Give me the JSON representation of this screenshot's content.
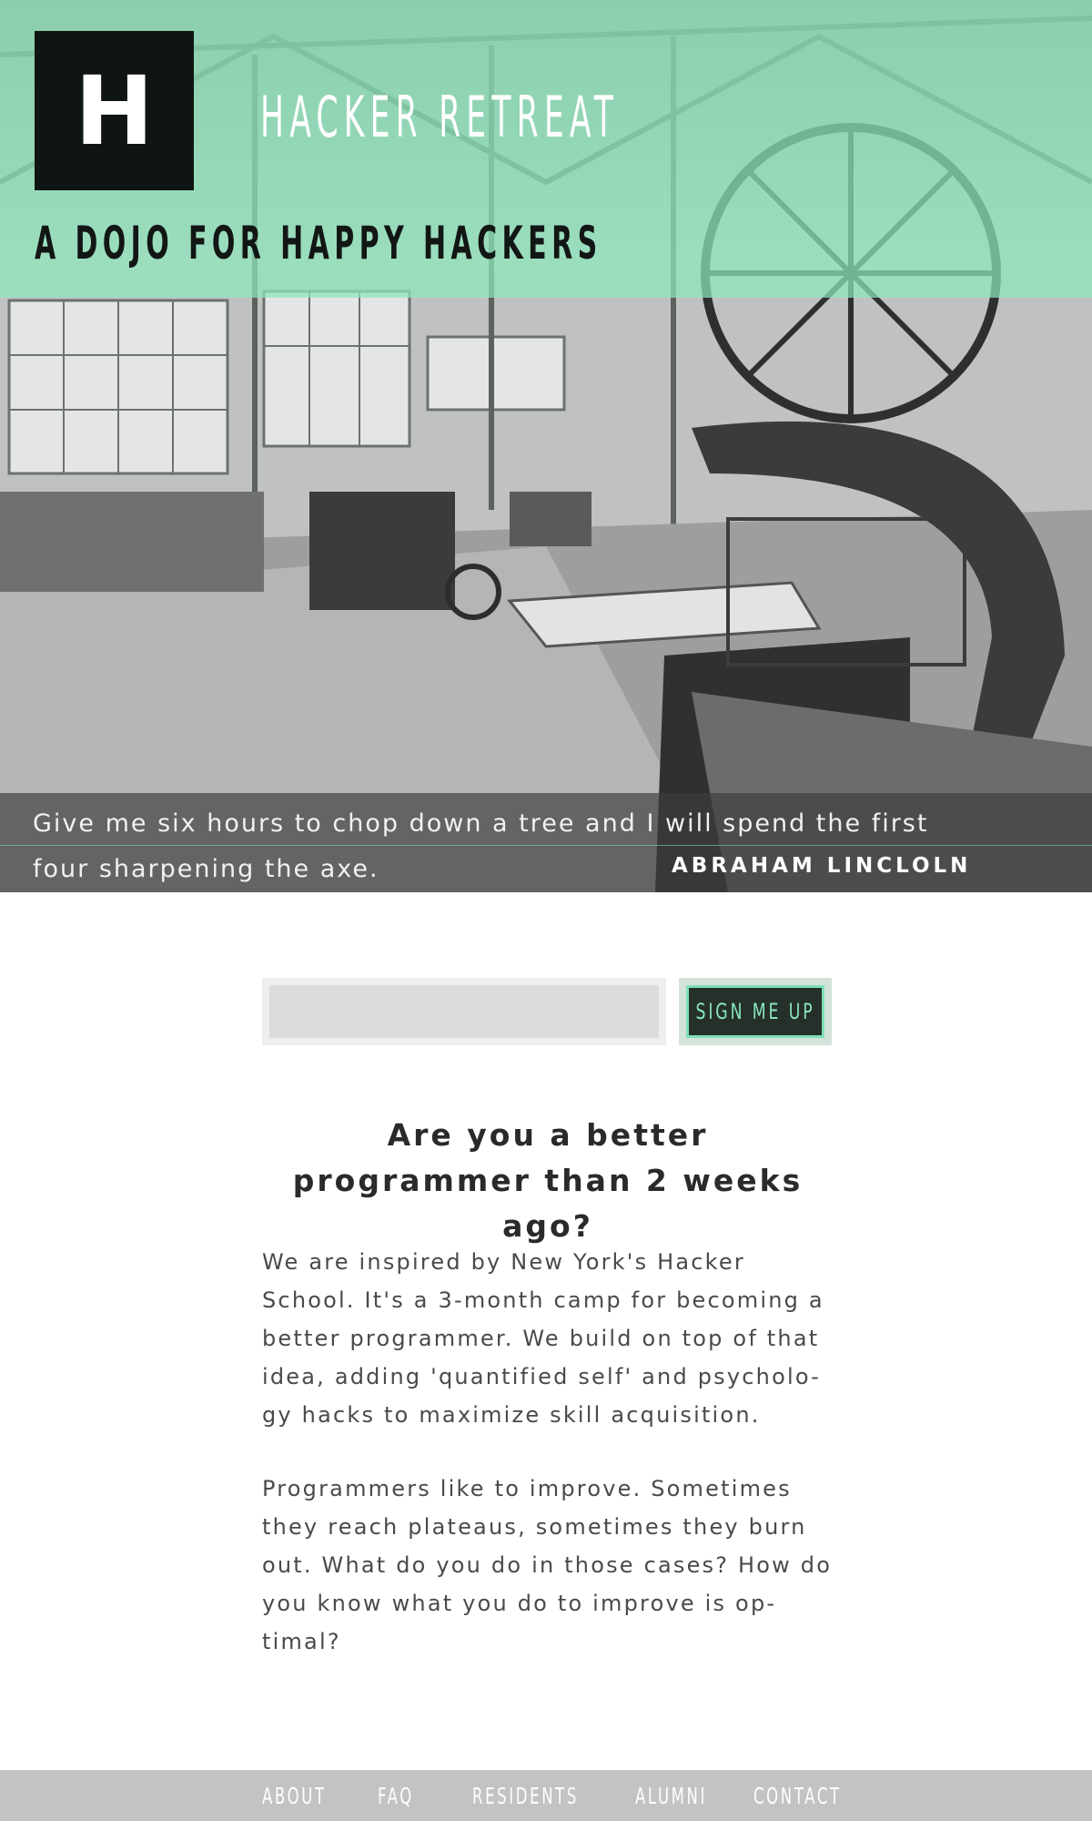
{
  "brand": {
    "logo_letter": "H",
    "title": "HACKER RETREAT",
    "tagline": "A DOJO FOR HAPPY HACKERS"
  },
  "quote": {
    "text": "Give me six hours to chop down a tree and I will spend the first four sharpening the axe.",
    "author": "ABRAHAM LINCLOLN"
  },
  "signup": {
    "email_value": "",
    "email_placeholder": "",
    "button_label": "SIGN ME UP"
  },
  "content": {
    "headline": "Are you a better programmer than 2 weeks ago?",
    "paragraphs": [
      "We are inspired by New York's Hacker School. It's a 3-month camp for becoming a better programmer. We build on top of that idea, adding 'quantified self' and psycholo-gy hacks to maximize skill acquisition.",
      "Programmers like to improve. Sometimes they reach plateaus, sometimes they burn out. What do you do in those cases? How do you know what you do to improve is op-timal?"
    ]
  },
  "footer": {
    "nav": [
      "ABOUT",
      "FAQ",
      "RESIDENTS",
      "ALUMNI",
      "CONTACT"
    ]
  },
  "colors": {
    "mint_overlay": "#8ce8bc",
    "logo_bg": "#0f1512",
    "button_bg": "#26302b",
    "button_text": "#86e6bb",
    "footer_bg": "#c3c3c3"
  }
}
